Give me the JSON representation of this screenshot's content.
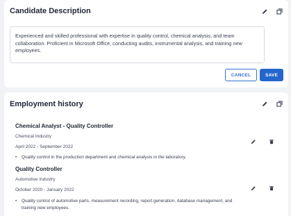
{
  "description_card": {
    "title": "Candidate Description",
    "text": "Experienced and skilled professional with expertise in quality control, chemical analysis, and team collaboration. Proficient in Microsoft Office, conducting audits, instrumental analysis, and training new employees.",
    "cancel_label": "CANCEL",
    "save_label": "SAVE"
  },
  "employment_card": {
    "title": "Employment history",
    "jobs": [
      {
        "title": "Chemical Analyst - Quality Controller",
        "industry": "Chemical Industry",
        "dates": "April 2022 - September 2022",
        "bullet": "Quality control in the production department and chemical analysis in the laboratory."
      },
      {
        "title": "Quality Controller",
        "industry": "Automotive Industry",
        "dates": "October 2020 - January 2022",
        "bullet": "Quality control of automotive parts, measurement recording, report generation, database management, and training new employees."
      }
    ]
  },
  "icons": {
    "edit": "pencil-icon",
    "expand": "expand-icon",
    "delete": "trash-icon"
  },
  "colors": {
    "accent": "#2466cc",
    "background": "#f1f2f5",
    "card": "#ffffff"
  }
}
